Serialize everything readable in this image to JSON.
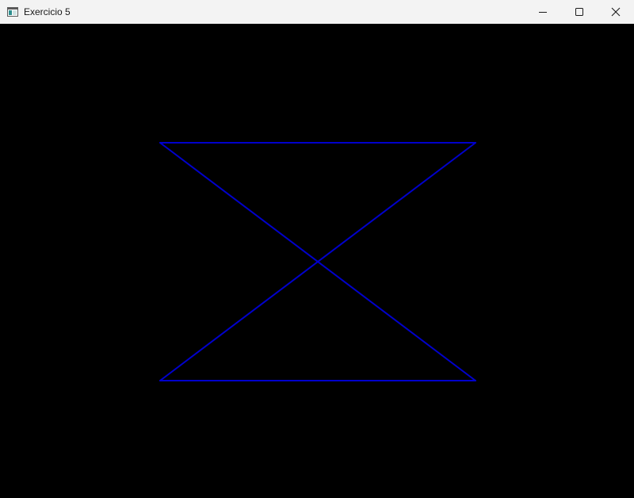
{
  "window": {
    "title": "Exercicio 5",
    "background_color": "#000000",
    "titlebar_color": "#f3f3f3"
  },
  "controls": {
    "minimize_icon": "minimize-icon",
    "maximize_icon": "maximize-icon",
    "close_icon": "close-icon"
  },
  "drawing": {
    "stroke_color": "#0000cc",
    "shape": "hourglass"
  }
}
